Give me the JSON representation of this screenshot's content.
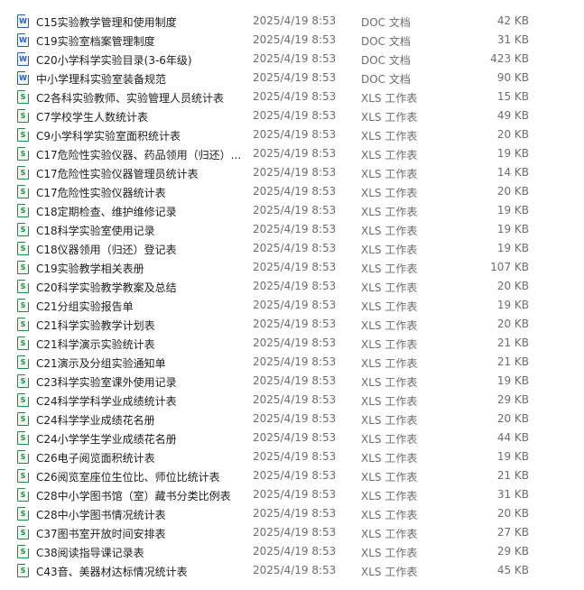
{
  "files": [
    {
      "name": "C15实验教学管理和使用制度",
      "date": "2025/4/19 8:53",
      "type": "DOC 文档",
      "size": "42 KB",
      "icon": "word-doc-icon",
      "glyph": "W"
    },
    {
      "name": "C19实验室档案管理制度",
      "date": "2025/4/19 8:53",
      "type": "DOC 文档",
      "size": "31 KB",
      "icon": "word-doc-icon",
      "glyph": "W"
    },
    {
      "name": "C20小学科学实验目录(3-6年级)",
      "date": "2025/4/19 8:53",
      "type": "DOC 文档",
      "size": "423 KB",
      "icon": "word-doc-icon",
      "glyph": "W"
    },
    {
      "name": "中小学理科实验室装备规范",
      "date": "2025/4/19 8:53",
      "type": "DOC 文档",
      "size": "90 KB",
      "icon": "word-doc-icon",
      "glyph": "W"
    },
    {
      "name": "C2各科实验教师、实验管理人员统计表",
      "date": "2025/4/19 8:53",
      "type": "XLS 工作表",
      "size": "15 KB",
      "icon": "excel-sheet-icon",
      "glyph": "S"
    },
    {
      "name": "C7学校学生人数统计表",
      "date": "2025/4/19 8:53",
      "type": "XLS 工作表",
      "size": "49 KB",
      "icon": "excel-sheet-icon",
      "glyph": "S"
    },
    {
      "name": "C9小学科学实验室面积统计表",
      "date": "2025/4/19 8:53",
      "type": "XLS 工作表",
      "size": "20 KB",
      "icon": "excel-sheet-icon",
      "glyph": "S"
    },
    {
      "name": "C17危险性实验仪器、药品领用（归还）...",
      "date": "2025/4/19 8:53",
      "type": "XLS 工作表",
      "size": "19 KB",
      "icon": "excel-sheet-icon",
      "glyph": "S"
    },
    {
      "name": "C17危险性实验仪器管理员统计表",
      "date": "2025/4/19 8:53",
      "type": "XLS 工作表",
      "size": "14 KB",
      "icon": "excel-sheet-icon",
      "glyph": "S"
    },
    {
      "name": "C17危险性实验仪器统计表",
      "date": "2025/4/19 8:53",
      "type": "XLS 工作表",
      "size": "20 KB",
      "icon": "excel-sheet-icon",
      "glyph": "S"
    },
    {
      "name": "C18定期检查、维护维修记录",
      "date": "2025/4/19 8:53",
      "type": "XLS 工作表",
      "size": "19 KB",
      "icon": "excel-sheet-icon",
      "glyph": "S"
    },
    {
      "name": "C18科学实验室使用记录",
      "date": "2025/4/19 8:53",
      "type": "XLS 工作表",
      "size": "19 KB",
      "icon": "excel-sheet-icon",
      "glyph": "S"
    },
    {
      "name": "C18仪器领用（归还）登记表",
      "date": "2025/4/19 8:53",
      "type": "XLS 工作表",
      "size": "19 KB",
      "icon": "excel-sheet-icon",
      "glyph": "S"
    },
    {
      "name": "C19实验教学相关表册",
      "date": "2025/4/19 8:53",
      "type": "XLS 工作表",
      "size": "107 KB",
      "icon": "excel-sheet-icon",
      "glyph": "S"
    },
    {
      "name": "C20科学实验教学教案及总结",
      "date": "2025/4/19 8:53",
      "type": "XLS 工作表",
      "size": "20 KB",
      "icon": "excel-sheet-icon",
      "glyph": "S"
    },
    {
      "name": "C21分组实验报告单",
      "date": "2025/4/19 8:53",
      "type": "XLS 工作表",
      "size": "19 KB",
      "icon": "excel-sheet-icon",
      "glyph": "S"
    },
    {
      "name": "C21科学实验教学计划表",
      "date": "2025/4/19 8:53",
      "type": "XLS 工作表",
      "size": "20 KB",
      "icon": "excel-sheet-icon",
      "glyph": "S"
    },
    {
      "name": "C21科学演示实验统计表",
      "date": "2025/4/19 8:53",
      "type": "XLS 工作表",
      "size": "21 KB",
      "icon": "excel-sheet-icon",
      "glyph": "S"
    },
    {
      "name": "C21演示及分组实验通知单",
      "date": "2025/4/19 8:53",
      "type": "XLS 工作表",
      "size": "21 KB",
      "icon": "excel-sheet-icon",
      "glyph": "S"
    },
    {
      "name": "C23科学实验室课外使用记录",
      "date": "2025/4/19 8:53",
      "type": "XLS 工作表",
      "size": "19 KB",
      "icon": "excel-sheet-icon",
      "glyph": "S"
    },
    {
      "name": "C24科学学科学业成绩统计表",
      "date": "2025/4/19 8:53",
      "type": "XLS 工作表",
      "size": "29 KB",
      "icon": "excel-sheet-icon",
      "glyph": "S"
    },
    {
      "name": "C24科学学业成绩花名册",
      "date": "2025/4/19 8:53",
      "type": "XLS 工作表",
      "size": "20 KB",
      "icon": "excel-sheet-icon",
      "glyph": "S"
    },
    {
      "name": "C24小学学生学业成绩花名册",
      "date": "2025/4/19 8:53",
      "type": "XLS 工作表",
      "size": "44 KB",
      "icon": "excel-sheet-icon",
      "glyph": "S"
    },
    {
      "name": "C26电子阅览面积统计表",
      "date": "2025/4/19 8:53",
      "type": "XLS 工作表",
      "size": "19 KB",
      "icon": "excel-sheet-icon",
      "glyph": "S"
    },
    {
      "name": "C26阅览室座位生位比、师位比统计表",
      "date": "2025/4/19 8:53",
      "type": "XLS 工作表",
      "size": "21 KB",
      "icon": "excel-sheet-icon",
      "glyph": "S"
    },
    {
      "name": "C28中小学图书馆（室）藏书分类比例表",
      "date": "2025/4/19 8:53",
      "type": "XLS 工作表",
      "size": "31 KB",
      "icon": "excel-sheet-icon",
      "glyph": "S"
    },
    {
      "name": "C28中小学图书情况统计表",
      "date": "2025/4/19 8:53",
      "type": "XLS 工作表",
      "size": "20 KB",
      "icon": "excel-sheet-icon",
      "glyph": "S"
    },
    {
      "name": "C37图书室开放时间安排表",
      "date": "2025/4/19 8:53",
      "type": "XLS 工作表",
      "size": "27 KB",
      "icon": "excel-sheet-icon",
      "glyph": "S"
    },
    {
      "name": "C38阅读指导课记录表",
      "date": "2025/4/19 8:53",
      "type": "XLS 工作表",
      "size": "29 KB",
      "icon": "excel-sheet-icon",
      "glyph": "S"
    },
    {
      "name": "C43音、美器材达标情况统计表",
      "date": "2025/4/19 8:53",
      "type": "XLS 工作表",
      "size": "45 KB",
      "icon": "excel-sheet-icon",
      "glyph": "S"
    }
  ]
}
